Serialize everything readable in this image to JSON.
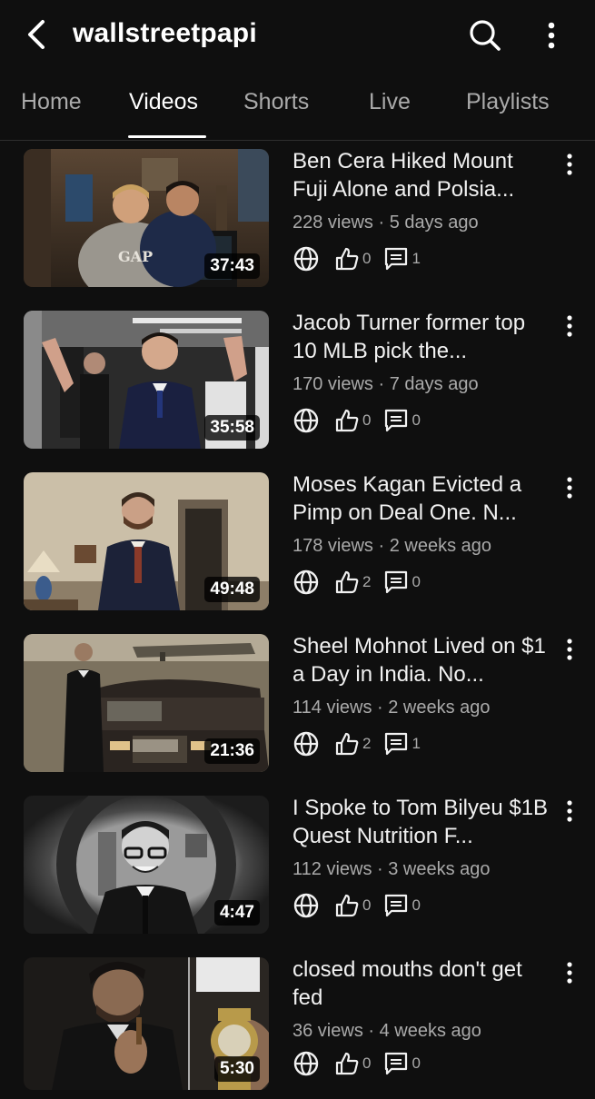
{
  "header": {
    "back_icon": "chevron-left-icon",
    "channel_name": "wallstreetpapi",
    "search_icon": "search-icon",
    "more_icon": "more-vertical-icon"
  },
  "tabs": [
    {
      "label": "Home"
    },
    {
      "label": "Videos",
      "active": true
    },
    {
      "label": "Shorts"
    },
    {
      "label": "Live"
    },
    {
      "label": "Playlists"
    }
  ],
  "videos": [
    {
      "title": "Ben Cera Hiked Mount Fuji Alone and Polsia...",
      "views": "228 views",
      "age": "5 days ago",
      "duration": "37:43",
      "likes": "0",
      "comments": "1"
    },
    {
      "title": "Jacob Turner former top 10 MLB pick the...",
      "views": "170 views",
      "age": "7 days ago",
      "duration": "35:58",
      "likes": "0",
      "comments": "0"
    },
    {
      "title": "Moses Kagan Evicted a Pimp on Deal One. N...",
      "views": "178 views",
      "age": "2 weeks ago",
      "duration": "49:48",
      "likes": "2",
      "comments": "0"
    },
    {
      "title": "Sheel Mohnot Lived on $1 a Day in India. No...",
      "views": "114 views",
      "age": "2 weeks ago",
      "duration": "21:36",
      "likes": "2",
      "comments": "1"
    },
    {
      "title": "I Spoke to Tom Bilyeu $1B Quest Nutrition F...",
      "views": "112 views",
      "age": "3 weeks ago",
      "duration": "4:47",
      "likes": "0",
      "comments": "0"
    },
    {
      "title": "closed mouths don't get fed",
      "views": "36 views",
      "age": "4 weeks ago",
      "duration": "5:30",
      "likes": "0",
      "comments": "0"
    }
  ],
  "separator": " · ",
  "colors": {
    "background": "#0f0f0f",
    "text_primary": "#f1f1f1",
    "text_secondary": "#aaaaaa",
    "divider": "#2e2e2e"
  }
}
